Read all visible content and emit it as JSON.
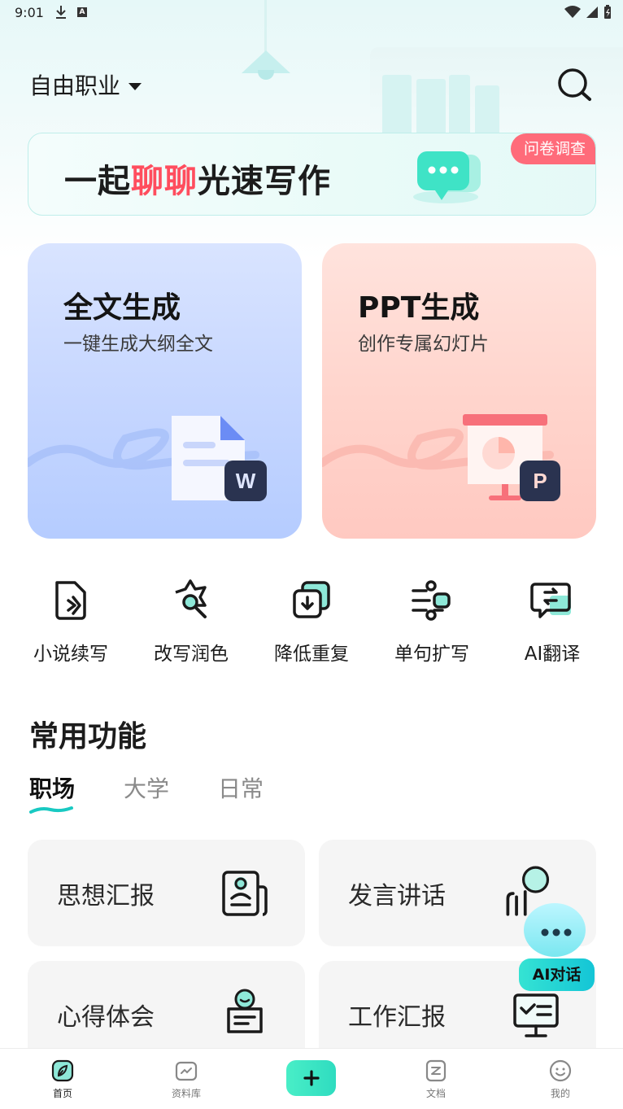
{
  "status_bar": {
    "time": "9:01"
  },
  "header": {
    "category": "自由职业"
  },
  "banner": {
    "title_part1": "一起",
    "title_highlight": "聊聊",
    "title_part2": "光速写作",
    "badge": "问卷调查"
  },
  "cards": [
    {
      "title": "全文生成",
      "subtitle": "一键生成大纲全文"
    },
    {
      "title": "PPT生成",
      "subtitle": "创作专属幻灯片"
    }
  ],
  "tools": [
    {
      "label": "小说续写",
      "icon": "document-arrow-icon"
    },
    {
      "label": "改写润色",
      "icon": "star-magnifier-icon"
    },
    {
      "label": "降低重复",
      "icon": "copy-download-icon"
    },
    {
      "label": "单句扩写",
      "icon": "expand-lines-icon"
    },
    {
      "label": "AI翻译",
      "icon": "translate-chat-icon"
    }
  ],
  "common": {
    "title": "常用功能",
    "tabs": [
      "职场",
      "大学",
      "日常"
    ],
    "active_tab": 0,
    "items": [
      {
        "label": "思想汇报",
        "icon": "report-person-icon"
      },
      {
        "label": "发言讲话",
        "icon": "speech-person-icon"
      },
      {
        "label": "心得体会",
        "icon": "reflection-doc-icon"
      },
      {
        "label": "工作汇报",
        "icon": "monitor-report-icon"
      }
    ]
  },
  "ai_float": {
    "label": "AI对话"
  },
  "bottom_nav": [
    {
      "label": "首页",
      "icon": "home-leaf-icon",
      "active": true
    },
    {
      "label": "资料库",
      "icon": "library-icon",
      "active": false
    },
    {
      "label": "",
      "icon": "plus-icon",
      "active": false
    },
    {
      "label": "文档",
      "icon": "document-icon",
      "active": false
    },
    {
      "label": "我的",
      "icon": "profile-face-icon",
      "active": false
    }
  ],
  "colors": {
    "accent": "#2fdcc0",
    "highlight": "#ff4d5e",
    "badge": "#ff6b7a",
    "card_blue": "#c7d7ff",
    "card_pink": "#ffd5cd"
  }
}
